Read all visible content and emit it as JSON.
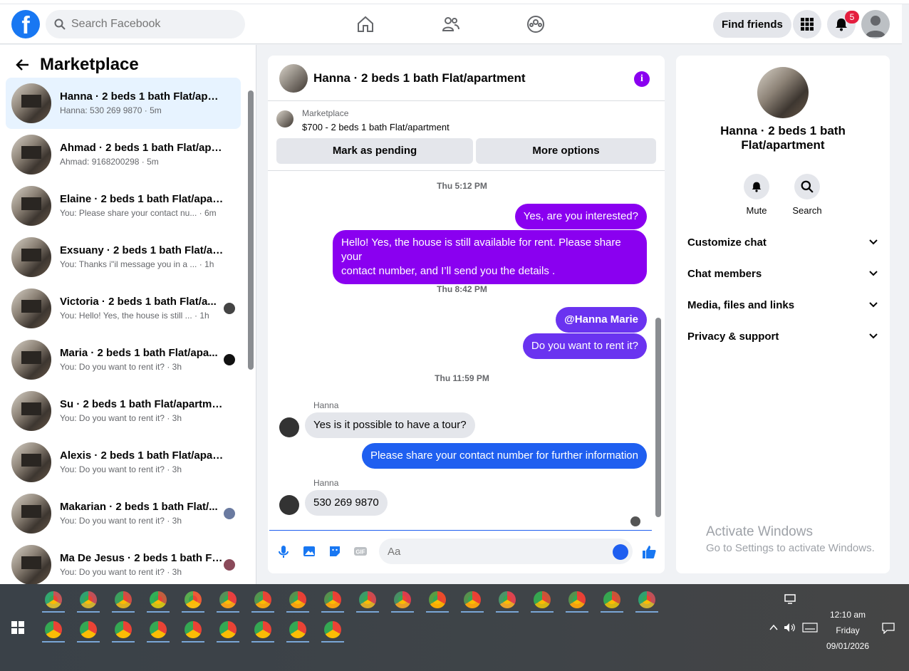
{
  "topbar": {
    "logo": "f",
    "search_placeholder": "Search Facebook",
    "find_friends": "Find friends",
    "notification_count": "5"
  },
  "sidebar": {
    "title": "Marketplace",
    "conversations": [
      {
        "name": "Hanna · 2 beds 1 bath Flat/apart...",
        "sub": "Hanna: 530 269 9870 · 5m",
        "active": true
      },
      {
        "name": "Ahmad · 2 beds 1 bath Flat/apar...",
        "sub": "Ahmad: 9168200298 · 5m"
      },
      {
        "name": "Elaine · 2 beds 1 bath Flat/apart...",
        "sub": "You: Please share your contact nu...  · 6m"
      },
      {
        "name": "Exsuany · 2 beds 1 bath Flat/apa...",
        "sub": "You: Thanks i\"il message you in a ...  · 1h"
      },
      {
        "name": "Victoria · 2 beds 1 bath Flat/a...",
        "sub": "You: Hello! Yes, the house is still ...  · 1h"
      },
      {
        "name": "Maria · 2 beds 1 bath Flat/apa...",
        "sub": "You: Do you want to rent it? · 3h"
      },
      {
        "name": "Su · 2 beds 1 bath Flat/apartment",
        "sub": "You: Do you want to rent it? · 3h"
      },
      {
        "name": "Alexis · 2 beds 1 bath Flat/apart...",
        "sub": "You: Do you want to rent it? · 3h"
      },
      {
        "name": "Makarian · 2 beds 1 bath Flat/...",
        "sub": "You: Do you want to rent it? · 3h"
      },
      {
        "name": "Ma De Jesus · 2 beds 1 bath Fl...",
        "sub": "You: Do you want to rent it? · 3h"
      }
    ]
  },
  "chat": {
    "title": "Hanna · 2 beds 1 bath Flat/apartment",
    "marketplace_label": "Marketplace",
    "listing": "$700 - 2 beds 1 bath Flat/apartment",
    "mark_pending": "Mark as pending",
    "more_options": "More options",
    "ts1": "Thu 5:12 PM",
    "msg1": "Yes, are you interested?",
    "msg2_line1": "Hello! Yes, the house is still available for rent. Please share your",
    "msg2_line2": "contact number, and I’ll send you the details .",
    "ts2": "Thu 8:42 PM",
    "msg3": "@Hanna Marie",
    "msg4": "Do you want to rent it?",
    "ts3": "Thu 11:59 PM",
    "sender1": "Hanna",
    "msg5": "Yes is it possible to have a tour?",
    "msg6": "Please share your contact number for further information",
    "sender2": "Hanna",
    "msg7": "530 269 9870",
    "compose_placeholder": "Aa"
  },
  "details": {
    "title_line1": "Hanna · 2 beds 1 bath",
    "title_line2": "Flat/apartment",
    "mute": "Mute",
    "search": "Search",
    "sections": [
      "Customize chat",
      "Chat members",
      "Media, files and links",
      "Privacy & support"
    ]
  },
  "watermark": {
    "line1": "Activate Windows",
    "line2": "Go to Settings to activate Windows."
  },
  "taskbar": {
    "time": "12:10 am",
    "day": "Friday",
    "date": "09/01/2026"
  }
}
